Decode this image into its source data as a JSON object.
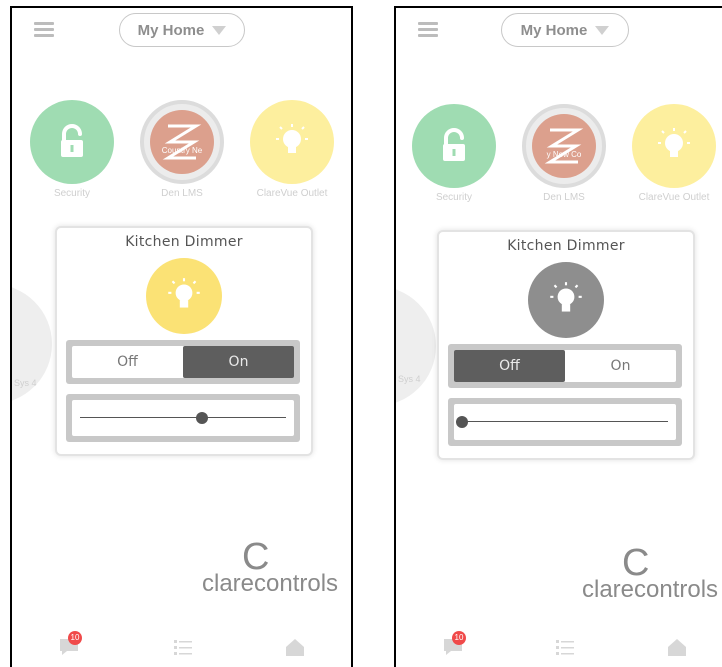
{
  "left": {
    "header": {
      "home_label": "My Home"
    },
    "tiles": [
      {
        "label": "Security"
      },
      {
        "label": "Den LMS",
        "overlay": "Country   Ne"
      },
      {
        "label": "ClareVue Outlet"
      }
    ],
    "side_label": "Sys 4",
    "dialog": {
      "title": "Kitchen Dimmer",
      "toggle": {
        "off": "Off",
        "on": "On",
        "state": "On"
      },
      "level": 0.59
    },
    "logo": "clarecontrols",
    "badge": "10"
  },
  "right": {
    "header": {
      "home_label": "My Home"
    },
    "tiles": [
      {
        "label": "Security"
      },
      {
        "label": "Den LMS",
        "overlay": "y   New Co"
      },
      {
        "label": "ClareVue Outlet"
      }
    ],
    "side_label": "Sys 4",
    "dialog": {
      "title": "Kitchen Dimmer",
      "toggle": {
        "off": "Off",
        "on": "On",
        "state": "Off"
      },
      "level": 0.0
    },
    "logo": "clarecontrols",
    "badge": "10"
  },
  "colors": {
    "security_green": "#9fdcb2",
    "outlet_yellow": "#fdef9e",
    "bulb_on": "#fbe275",
    "bulb_off": "#8e8e8e",
    "badge_red": "#f04a4a",
    "toggle_active": "#5e5e5e"
  },
  "icons": [
    "hamburger-icon",
    "caret-down-icon",
    "unlock-icon",
    "lms-logo-icon",
    "bulb-icon",
    "chat-icon",
    "list-icon",
    "home-icon"
  ]
}
